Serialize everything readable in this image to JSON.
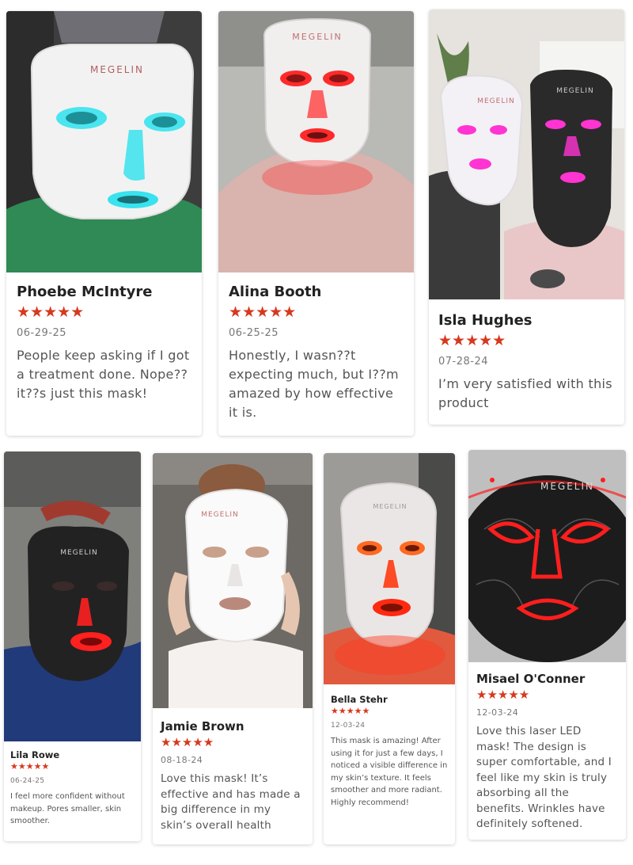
{
  "reviews": [
    {
      "name": "Phoebe McIntyre",
      "rating": 5,
      "stars": "★★★★★",
      "date": "06-29-25",
      "text": "People keep asking if I got a treatment done. Nope??it??s just this mask!",
      "photo": {
        "mask_color": "#ffffff",
        "glow_color": "#37e3ee",
        "background": "#3d3d3d",
        "shirt": "#2f8a56",
        "brand": "MEGELIN"
      }
    },
    {
      "name": "Alina Booth",
      "rating": 5,
      "stars": "★★★★★",
      "date": "06-25-25",
      "text": "Honestly, I wasn??t expecting much, but I??m amazed by how effective it is.",
      "photo": {
        "mask_color": "#f1eeee",
        "glow_color": "#ff2a2a",
        "background": "#b9b9b6",
        "shirt": "#d9b3ad",
        "brand": "MEGELIN"
      }
    },
    {
      "name": "Isla Hughes",
      "rating": 5,
      "stars": "★★★★★",
      "date": "07-28-24",
      "text": "I’m very satisfied with this product",
      "photo": {
        "mask_color": "#f4f1f6",
        "mask2_color": "#2a2a2a",
        "glow_color": "#ff34d2",
        "background": "#e6e2dd",
        "shirt": "#e9c7c9",
        "brand": "MEGELIN"
      }
    },
    {
      "name": "Lila Rowe",
      "rating": 5,
      "stars": "★★★★★",
      "date": "06-24-25",
      "text": "I feel more confident without makeup. Pores smaller, skin smoother.",
      "photo": {
        "mask_color": "#222222",
        "glow_color": "#ff2020",
        "background": "#7f7f7c",
        "shirt": "#213a7a",
        "brand": "MEGELIN"
      }
    },
    {
      "name": "Jamie Brown",
      "rating": 5,
      "stars": "★★★★★",
      "date": "08-18-24",
      "text": "Love this mask! It’s effective and has made a big difference in my skin’s overall health",
      "photo": {
        "mask_color": "#fbfafa",
        "glow_color": "#ffffff",
        "background": "#6d6a66",
        "shirt": "#f4f1ef",
        "brand": "MEGELIN"
      }
    },
    {
      "name": "Bella Stehr",
      "rating": 5,
      "stars": "★★★★★",
      "date": "12-03-24",
      "text": "This mask is amazing! After using it for just a few days, I noticed a visible difference in my skin’s texture. It feels smoother and more radiant. Highly recommend!",
      "photo": {
        "mask_color": "#ebe6e6",
        "glow_color": "#ff2a10",
        "background": "#9c9b98",
        "shirt": "#e15a3e",
        "brand": "MEGELIN"
      }
    },
    {
      "name": "Misael O'Conner",
      "rating": 5,
      "stars": "★★★★★",
      "date": "12-03-24",
      "text": "Love this laser LED mask! The design is super comfortable, and I feel like my skin is truly absorbing all the benefits. Wrinkles have definitely softened.",
      "photo": {
        "mask_color": "#1c1c1c",
        "glow_color": "#ff1e1e",
        "background": "#bfbfbf",
        "shirt": "#1c1c1c",
        "brand": "MEGELIN"
      }
    }
  ]
}
